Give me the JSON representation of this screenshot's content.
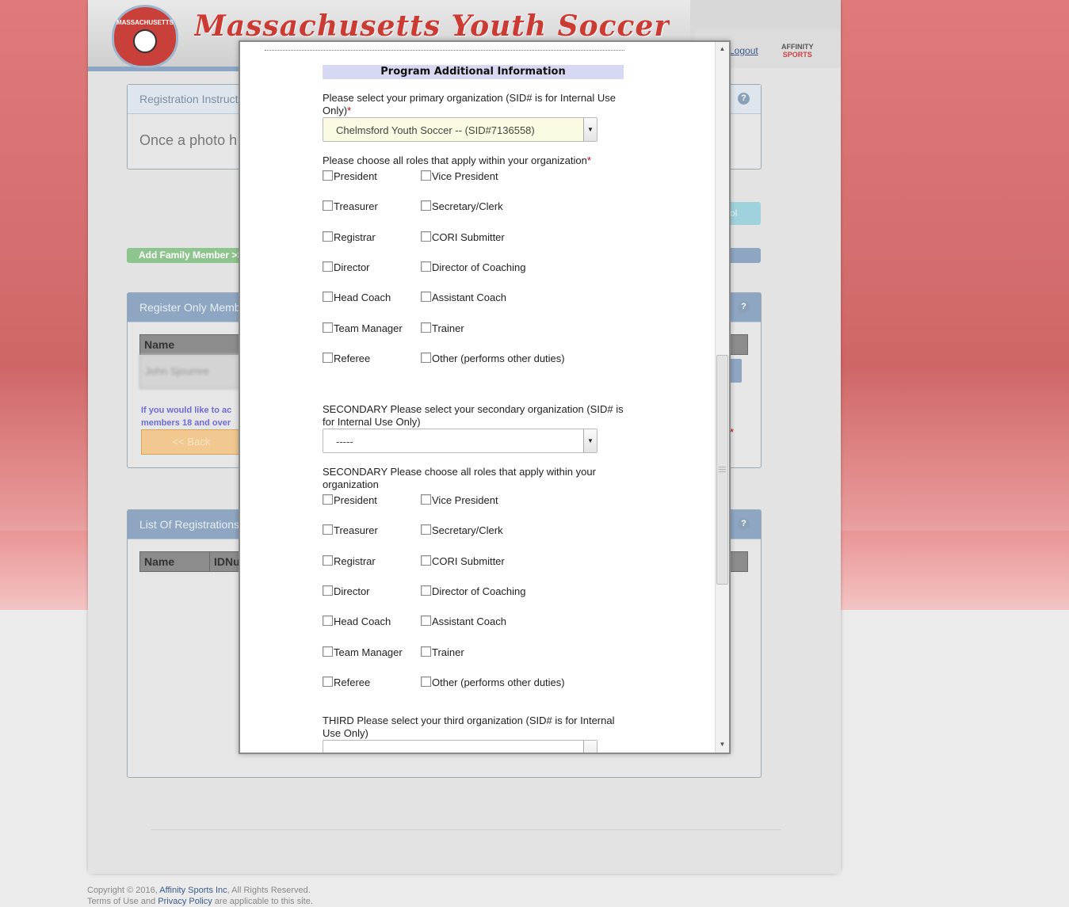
{
  "header": {
    "logo_text": "MASSACHUSETTS",
    "brand_title": "Massachusetts Youth Soccer",
    "logout": "Logout",
    "affinity_top": "AFFINITY",
    "affinity_bottom": "SPORTS"
  },
  "background": {
    "registration_instructions": "Registration Instruct",
    "photo_text": "Once a photo h",
    "add_family_member": "Add Family Member >>",
    "register_only_members": "Register Only Memb",
    "name_col": "Name",
    "member_name": "John Sjournre",
    "info_text_1": "If you would like to ac",
    "info_text_2": "members 18 and over",
    "back_button": "<< Back",
    "list_of_registrations": "List Of Registrations",
    "reg_name_col": "Name",
    "reg_id_col": "IDNu",
    "help": "?",
    "right_button": "ol"
  },
  "modal": {
    "section_title": "Program Additional Information",
    "primary": {
      "question": "Please select your primary organization (SID# is for Internal Use Only)",
      "required": "*",
      "selected": "Chelmsford Youth Soccer -- (SID#7136558)",
      "roles_question": "Please choose all roles that apply within your organization",
      "roles_required": "*"
    },
    "secondary": {
      "question": "SECONDARY Please select your secondary organization (SID# is for Internal Use Only)",
      "selected": "-----",
      "roles_question": "SECONDARY Please choose all roles that apply within your organization"
    },
    "third": {
      "question": "THIRD Please select your third organization (SID# is for Internal Use Only)"
    },
    "roles_left": [
      "President",
      "Treasurer",
      "Registrar",
      "Director",
      "Head Coach",
      "Team Manager",
      "Referee"
    ],
    "roles_right": [
      "Vice President",
      "Secretary/Clerk",
      "CORI Submitter",
      "Director of Coaching",
      "Assistant Coach",
      "Trainer",
      "Other (performs other duties)"
    ],
    "arrow": "▼"
  },
  "footer": {
    "copyright_prefix": "Copyright © 2016, ",
    "company": "Affinity Sports Inc",
    "copyright_suffix": ", All Rights Reserved.",
    "terms_prefix": "Terms of Use and ",
    "privacy": "Privacy Policy",
    "terms_suffix": " are applicable to this site."
  }
}
